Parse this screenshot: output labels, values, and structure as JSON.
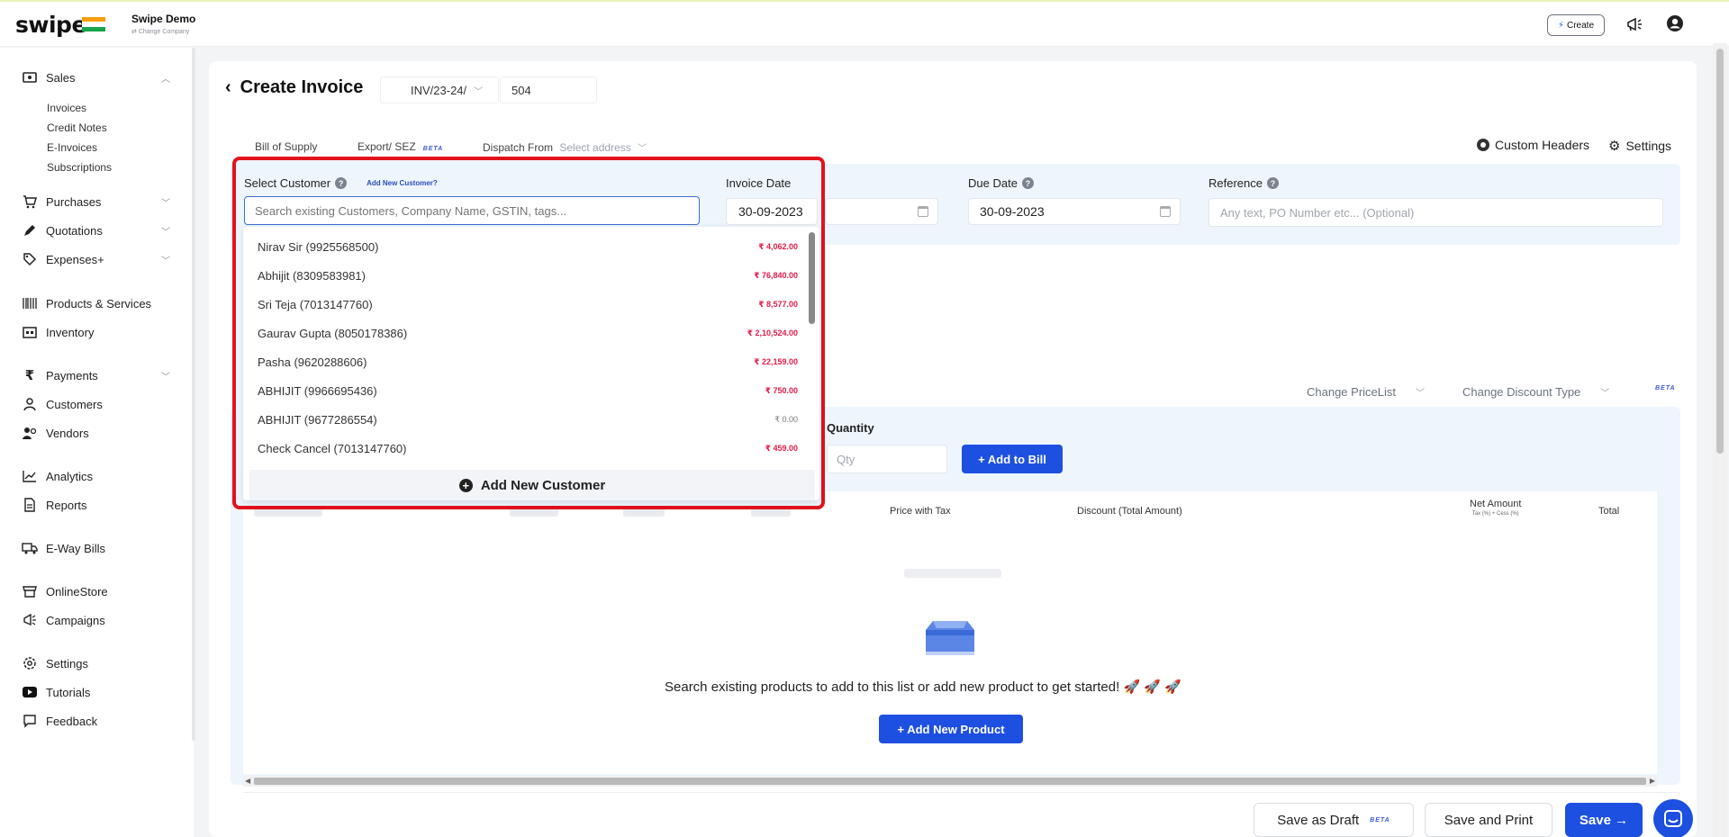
{
  "header": {
    "brand": "swipe",
    "company_name": "Swipe Demo",
    "company_sub": "⇄ Change Company",
    "create_label": "Create",
    "icons": [
      "bolt-icon",
      "megaphone-icon",
      "user-icon"
    ]
  },
  "sidebar": {
    "sales": "Sales",
    "sales_sub": [
      "Invoices",
      "Credit Notes",
      "E-Invoices",
      "Subscriptions"
    ],
    "purchases": "Purchases",
    "quotations": "Quotations",
    "expenses": "Expenses+",
    "products": "Products & Services",
    "inventory": "Inventory",
    "payments": "Payments",
    "customers": "Customers",
    "vendors": "Vendors",
    "analytics": "Analytics",
    "reports": "Reports",
    "eway": "E-Way Bills",
    "onlinestore": "OnlineStore",
    "campaigns": "Campaigns",
    "settings": "Settings",
    "tutorials": "Tutorials",
    "feedback": "Feedback"
  },
  "page": {
    "title": "Create Invoice",
    "inv_prefix": "INV/23-24/",
    "inv_number": "504",
    "bill_of_supply": "Bill of Supply",
    "export_sez": "Export/ SEZ",
    "beta": "BETA",
    "dispatch_from": "Dispatch From",
    "select_address": "Select address",
    "custom_headers": "Custom Headers",
    "settings": "Settings"
  },
  "form": {
    "select_customer": "Select Customer",
    "add_new_customer_link": "Add New Customer?",
    "search_placeholder": "Search existing Customers, Company Name, GSTIN, tags...",
    "invoice_date_label": "Invoice Date",
    "invoice_date": "30-09-2023",
    "due_date_label": "Due Date",
    "due_date": "30-09-2023",
    "reference_label": "Reference",
    "reference_placeholder": "Any text, PO Number etc... (Optional)"
  },
  "customers": [
    {
      "name": "Nirav Sir (9925568500)",
      "amount": "₹ 4,062.00"
    },
    {
      "name": "Abhijit (8309583981)",
      "amount": "₹ 76,840.00"
    },
    {
      "name": "Sri Teja (7013147760)",
      "amount": "₹ 8,577.00"
    },
    {
      "name": "Gaurav Gupta (8050178386)",
      "amount": "₹ 2,10,524.00"
    },
    {
      "name": "Pasha (9620288606)",
      "amount": "₹ 22,159.00"
    },
    {
      "name": "ABHIJIT (9966695436)",
      "amount": "₹ 750.00"
    },
    {
      "name": "ABHIJIT (9677286554)",
      "amount": "₹ 0.00"
    },
    {
      "name": "Check Cancel (7013147760)",
      "amount": "₹ 459.00"
    }
  ],
  "dropdown": {
    "add_new_customer": "Add New Customer"
  },
  "products": {
    "change_pricelist": "Change PriceList",
    "change_discount_type": "Change Discount Type",
    "beta": "BETA",
    "quantity_label": "Quantity",
    "qty_placeholder": "Qty",
    "add_to_bill": "+ Add to Bill",
    "col_price_with_tax": "Price with Tax",
    "col_discount": "Discount (Total Amount)",
    "col_net_amount": "Net Amount",
    "col_net_amount_sub": "Tax (%) + Cess (%)",
    "col_total": "Total",
    "empty_message": "Search existing products to add to this list or add new product to get started!",
    "empty_emoji": "🚀 🚀 🚀",
    "add_new_product": "+ Add New Product"
  },
  "footer": {
    "save_draft": "Save as Draft",
    "beta": "BETA",
    "save_print": "Save and Print",
    "save": "Save →"
  },
  "colors": {
    "primary": "#1d4fe0",
    "highlight_border": "#e1131d",
    "amount_red": "#e11d48",
    "panel_bg": "#eef5fd"
  }
}
